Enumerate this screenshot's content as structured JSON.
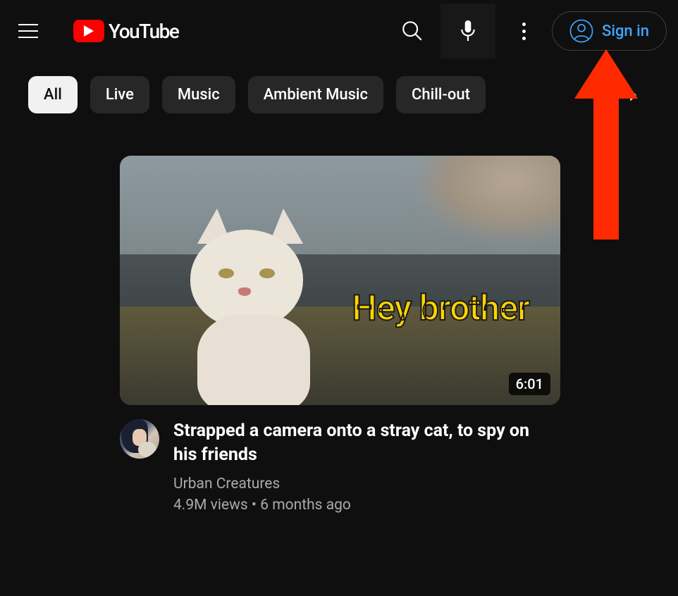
{
  "header": {
    "logo_text": "YouTube",
    "signin_label": "Sign in"
  },
  "chips": [
    {
      "label": "All",
      "active": true
    },
    {
      "label": "Live",
      "active": false
    },
    {
      "label": "Music",
      "active": false
    },
    {
      "label": "Ambient Music",
      "active": false
    },
    {
      "label": "Chill-out",
      "active": false
    }
  ],
  "video": {
    "overlay_text": "Hey brother",
    "duration": "6:01",
    "title": "Strapped a camera onto a stray cat, to spy on his friends",
    "channel": "Urban Creatures",
    "stats": "4.9M views  •  6 months ago"
  }
}
